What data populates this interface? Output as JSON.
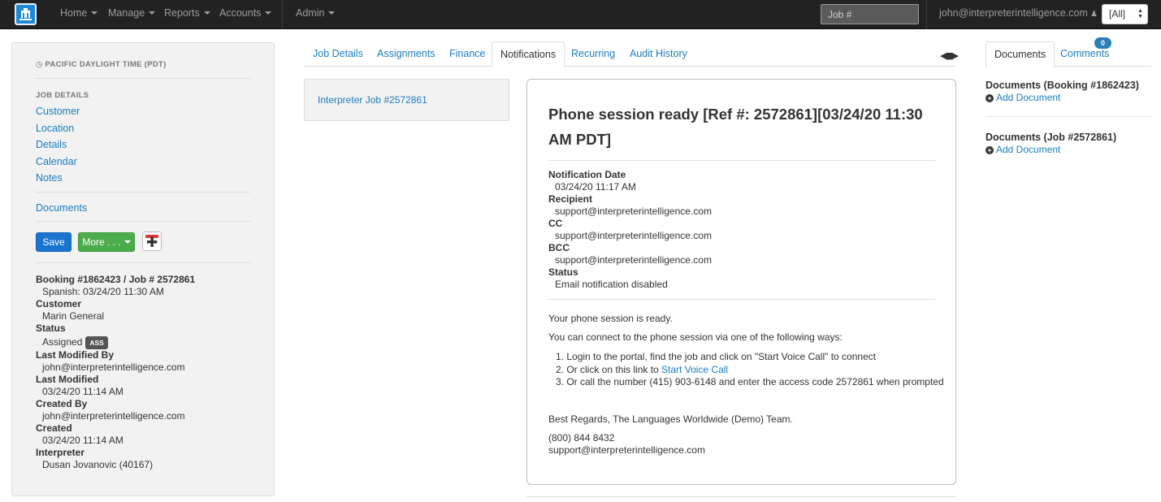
{
  "navbar": {
    "menus": [
      "Home",
      "Manage",
      "Reports",
      "Accounts"
    ],
    "admin": "Admin",
    "job_search_placeholder": "Job #",
    "user": "john@interpreterintelligence.com",
    "scope": "[All]"
  },
  "left": {
    "timezone": "PACIFIC DAYLIGHT TIME (PDT)",
    "section_heading": "JOB DETAILS",
    "links": [
      "Customer",
      "Location",
      "Details",
      "Calendar",
      "Notes"
    ],
    "documents_link": "Documents",
    "save_label": "Save",
    "more_label": "More . . .",
    "summary": {
      "booking_line": "Booking #1862423 / Job # 2572861",
      "language_line": "Spanish: 03/24/20 11:30 AM",
      "customer_label": "Customer",
      "customer": "Marin General",
      "status_label": "Status",
      "status": "Assigned",
      "status_badge": "ASS",
      "last_modified_by_label": "Last Modified By",
      "last_modified_by": "john@interpreterintelligence.com",
      "last_modified_label": "Last Modified",
      "last_modified": "03/24/20 11:14 AM",
      "created_by_label": "Created By",
      "created_by": "john@interpreterintelligence.com",
      "created_label": "Created",
      "created": "03/24/20 11:14 AM",
      "interpreter_label": "Interpreter",
      "interpreter": "Dusan Jovanovic (40167)"
    }
  },
  "tabs": {
    "items": [
      "Job Details",
      "Assignments",
      "Finance",
      "Notifications",
      "Recurring",
      "Audit History"
    ],
    "active": "Notifications"
  },
  "job_list": {
    "item": "Interpreter Job #2572861"
  },
  "notification": {
    "title": "Phone session ready [Ref #: 2572861][03/24/20 11:30 AM PDT]",
    "fields": {
      "date_label": "Notification Date",
      "date": "03/24/20 11:17 AM",
      "recipient_label": "Recipient",
      "recipient": "support@interpreterintelligence.com",
      "cc_label": "CC",
      "cc": "support@interpreterintelligence.com",
      "bcc_label": "BCC",
      "bcc": "support@interpreterintelligence.com",
      "status_label": "Status",
      "status": "Email notification disabled"
    },
    "body_line1": "Your phone session is ready.",
    "body_line2": "You can connect to the phone session via one of the following ways:",
    "steps": {
      "step1": "1. Login to the portal, find the job and click on \"Start Voice Call\" to connect",
      "step2_prefix": "2. Or click on this link to ",
      "step2_link": "Start Voice Call",
      "step3": "3. Or call the number (415) 903-6148 and enter the access code 2572861 when prompted"
    },
    "regards": "Best Regards, The Languages Worldwide (Demo) Team.",
    "phone": "(800) 844 8432",
    "email": "support@interpreterintelligence.com"
  },
  "right": {
    "tabs": [
      "Documents",
      "Comments"
    ],
    "comments_count": "0",
    "booking_docs_title": "Documents (Booking #1862423)",
    "job_docs_title": "Documents (Job #2572861)",
    "add_document": "Add Document"
  }
}
